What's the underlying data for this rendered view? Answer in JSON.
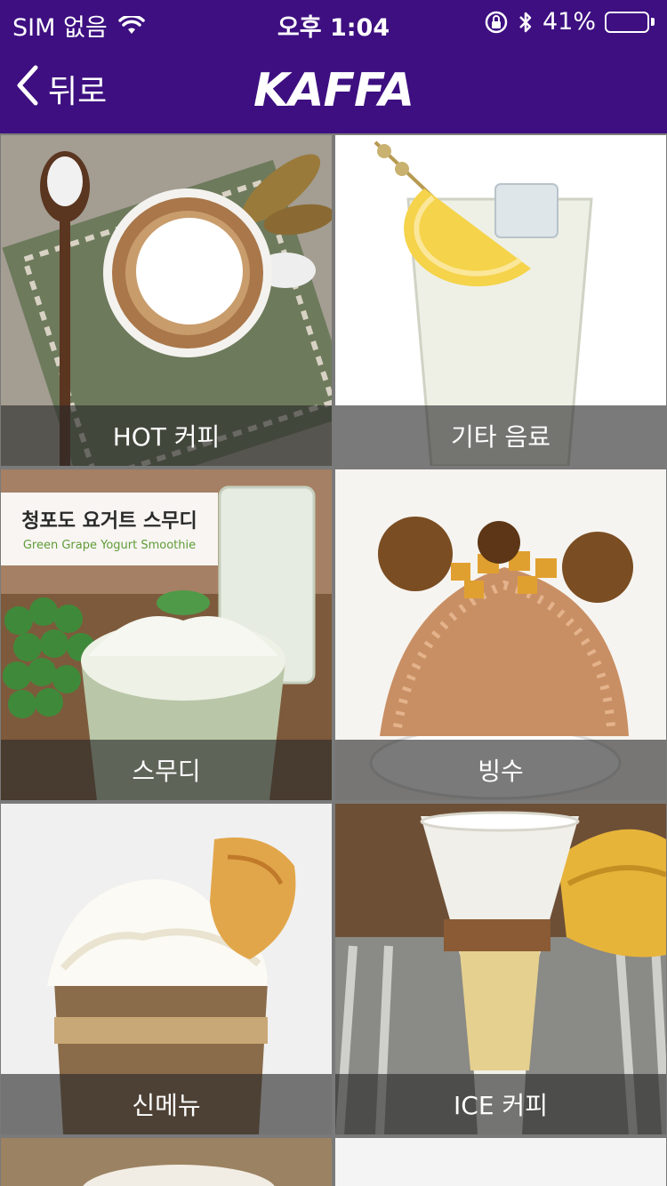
{
  "status_bar": {
    "carrier": "SIM 없음",
    "time": "오후 1:04",
    "battery": "41%",
    "battery_level": 0.41,
    "icons": [
      "wifi-icon",
      "rotation-lock-icon",
      "bluetooth-icon",
      "battery-icon"
    ]
  },
  "nav": {
    "back_label": "뒤로",
    "logo_text": "KAFFA"
  },
  "colors": {
    "nav_background": "#3d0f80",
    "caption_background": "rgba(40,40,40,0.62)"
  },
  "menu": {
    "items": [
      {
        "label": "HOT 커피"
      },
      {
        "label": "기타 음료"
      },
      {
        "label": "스무디",
        "promo_title": "청포도 요거트 스무디",
        "promo_subtitle": "Green Grape Yogurt Smoothie"
      },
      {
        "label": "빙수"
      },
      {
        "label": "신메뉴"
      },
      {
        "label": "ICE 커피"
      }
    ]
  }
}
